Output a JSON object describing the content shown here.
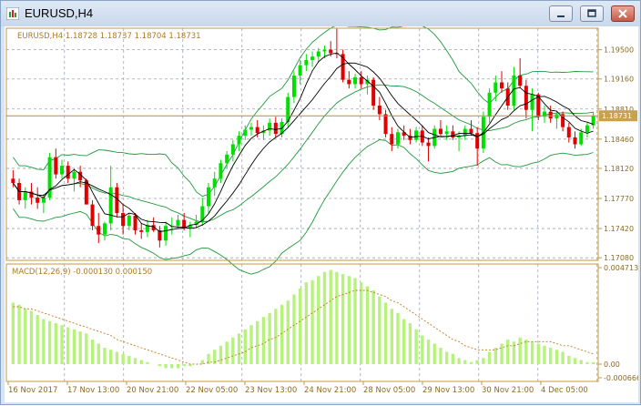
{
  "window": {
    "title": "EURUSD,H4",
    "buttons": [
      "minimize-icon",
      "restore-icon",
      "close-icon"
    ]
  },
  "colors": {
    "grid": "#9aa5b5",
    "axis": "#c89a3c",
    "bull": "#00e000",
    "bear": "#e00000",
    "bands": "#1f9a3a",
    "ma": "#000000",
    "macd_hist": "#b6f27c",
    "macd_signal": "#c8781e",
    "price_line": "#b08d4a"
  },
  "chart_data": {
    "type": "candlestick",
    "symbol_info": "EURUSD,H4  1.18728 1.18737 1.18704 1.18731",
    "current_price_label": "1.18731",
    "current_price": 1.18731,
    "price_axis_ticks": [
      "1.19500",
      "1.19160",
      "1.18810",
      "1.18460",
      "1.18120",
      "1.17770",
      "1.17420",
      "1.17080"
    ],
    "price_axis_values": [
      1.195,
      1.1916,
      1.1881,
      1.1846,
      1.1812,
      1.1777,
      1.1742,
      1.1708
    ],
    "ylim": [
      1.1705,
      1.1975
    ],
    "time_axis_labels": [
      "16 Nov 2017",
      "17 Nov 13:00",
      "20 Nov 21:00",
      "22 Nov 05:00",
      "23 Nov 13:00",
      "24 Nov 21:00",
      "28 Nov 05:00",
      "29 Nov 13:00",
      "30 Nov 21:00",
      "4 Dec 05:00"
    ],
    "candles": [
      [
        1.18,
        1.181,
        1.179,
        1.1795
      ],
      [
        1.1795,
        1.18,
        1.177,
        1.1775
      ],
      [
        1.1775,
        1.179,
        1.1765,
        1.1785
      ],
      [
        1.1785,
        1.1795,
        1.177,
        1.1778
      ],
      [
        1.1778,
        1.179,
        1.1765,
        1.1772
      ],
      [
        1.1772,
        1.1782,
        1.176,
        1.1778
      ],
      [
        1.1778,
        1.183,
        1.1775,
        1.1825
      ],
      [
        1.1825,
        1.1835,
        1.18,
        1.1805
      ],
      [
        1.1805,
        1.1822,
        1.18,
        1.1815
      ],
      [
        1.1815,
        1.182,
        1.1795,
        1.18
      ],
      [
        1.18,
        1.1812,
        1.1785,
        1.1808
      ],
      [
        1.1808,
        1.1815,
        1.179,
        1.1798
      ],
      [
        1.1798,
        1.18,
        1.177,
        1.177
      ],
      [
        1.177,
        1.1775,
        1.174,
        1.1745
      ],
      [
        1.1745,
        1.176,
        1.1725,
        1.1735
      ],
      [
        1.1735,
        1.175,
        1.1728,
        1.1748
      ],
      [
        1.1748,
        1.1815,
        1.174,
        1.179
      ],
      [
        1.179,
        1.1795,
        1.1755,
        1.176
      ],
      [
        1.176,
        1.177,
        1.1735,
        1.1745
      ],
      [
        1.1745,
        1.176,
        1.174,
        1.1757
      ],
      [
        1.1757,
        1.176,
        1.1735,
        1.174
      ],
      [
        1.174,
        1.1748,
        1.173,
        1.1738
      ],
      [
        1.1738,
        1.1752,
        1.1732,
        1.1746
      ],
      [
        1.1746,
        1.1755,
        1.1738,
        1.174
      ],
      [
        1.174,
        1.1745,
        1.172,
        1.1728
      ],
      [
        1.1728,
        1.175,
        1.1722,
        1.1745
      ],
      [
        1.1745,
        1.1755,
        1.1735,
        1.1745
      ],
      [
        1.1745,
        1.1758,
        1.1742,
        1.1752
      ],
      [
        1.1752,
        1.176,
        1.174,
        1.1742
      ],
      [
        1.1742,
        1.175,
        1.1732,
        1.1746
      ],
      [
        1.1746,
        1.1758,
        1.1742,
        1.175
      ],
      [
        1.175,
        1.1778,
        1.1745,
        1.1768
      ],
      [
        1.1768,
        1.1795,
        1.176,
        1.179
      ],
      [
        1.179,
        1.1808,
        1.178,
        1.18
      ],
      [
        1.18,
        1.1822,
        1.1795,
        1.1818
      ],
      [
        1.1818,
        1.1832,
        1.1812,
        1.1828
      ],
      [
        1.1828,
        1.1845,
        1.182,
        1.184
      ],
      [
        1.184,
        1.1855,
        1.1832,
        1.185
      ],
      [
        1.185,
        1.1862,
        1.1845,
        1.1857
      ],
      [
        1.1857,
        1.1865,
        1.185,
        1.186
      ],
      [
        1.186,
        1.1868,
        1.1848,
        1.1853
      ],
      [
        1.1853,
        1.1862,
        1.1845,
        1.1856
      ],
      [
        1.1856,
        1.187,
        1.185,
        1.1865
      ],
      [
        1.1865,
        1.1872,
        1.1848,
        1.1852
      ],
      [
        1.1852,
        1.187,
        1.1848,
        1.1866
      ],
      [
        1.1866,
        1.19,
        1.186,
        1.1895
      ],
      [
        1.1895,
        1.1925,
        1.1888,
        1.192
      ],
      [
        1.192,
        1.1938,
        1.191,
        1.1932
      ],
      [
        1.1932,
        1.1945,
        1.1925,
        1.1938
      ],
      [
        1.1938,
        1.1948,
        1.193,
        1.1942
      ],
      [
        1.1942,
        1.1952,
        1.1935,
        1.1948
      ],
      [
        1.1948,
        1.1955,
        1.194,
        1.195
      ],
      [
        1.195,
        1.196,
        1.1942,
        1.1946
      ],
      [
        1.1946,
        1.1975,
        1.194,
        1.1945
      ],
      [
        1.1945,
        1.195,
        1.1912,
        1.1915
      ],
      [
        1.1915,
        1.1925,
        1.1905,
        1.191
      ],
      [
        1.191,
        1.1922,
        1.1905,
        1.1918
      ],
      [
        1.1918,
        1.1925,
        1.1905,
        1.191
      ],
      [
        1.191,
        1.192,
        1.1898,
        1.1915
      ],
      [
        1.1915,
        1.1918,
        1.188,
        1.1885
      ],
      [
        1.1885,
        1.1895,
        1.1868,
        1.1875
      ],
      [
        1.1875,
        1.188,
        1.1848,
        1.1852
      ],
      [
        1.1852,
        1.186,
        1.1832,
        1.184
      ],
      [
        1.184,
        1.1858,
        1.1835,
        1.1854
      ],
      [
        1.1854,
        1.1862,
        1.1845,
        1.185
      ],
      [
        1.185,
        1.1858,
        1.184,
        1.1845
      ],
      [
        1.1845,
        1.186,
        1.1842,
        1.1856
      ],
      [
        1.1856,
        1.1862,
        1.1838,
        1.1842
      ],
      [
        1.1842,
        1.1848,
        1.182,
        1.1838
      ],
      [
        1.1838,
        1.1862,
        1.1835,
        1.1858
      ],
      [
        1.1858,
        1.1868,
        1.185,
        1.1852
      ],
      [
        1.1852,
        1.1862,
        1.1845,
        1.1855
      ],
      [
        1.1855,
        1.1862,
        1.1845,
        1.1848
      ],
      [
        1.1848,
        1.1855,
        1.1832,
        1.185
      ],
      [
        1.185,
        1.1862,
        1.1845,
        1.1858
      ],
      [
        1.1858,
        1.1868,
        1.185,
        1.1853
      ],
      [
        1.1853,
        1.186,
        1.1815,
        1.1835
      ],
      [
        1.1835,
        1.1878,
        1.183,
        1.1872
      ],
      [
        1.1872,
        1.1905,
        1.1865,
        1.19
      ],
      [
        1.19,
        1.192,
        1.189,
        1.1912
      ],
      [
        1.1912,
        1.1925,
        1.19,
        1.1905
      ],
      [
        1.1905,
        1.1912,
        1.188,
        1.1885
      ],
      [
        1.1885,
        1.193,
        1.188,
        1.192
      ],
      [
        1.192,
        1.194,
        1.1905,
        1.1908
      ],
      [
        1.1908,
        1.1915,
        1.187,
        1.188
      ],
      [
        1.188,
        1.1905,
        1.1855,
        1.1898
      ],
      [
        1.1898,
        1.19,
        1.1868,
        1.1872
      ],
      [
        1.1872,
        1.1885,
        1.1865,
        1.1878
      ],
      [
        1.1878,
        1.1885,
        1.1865,
        1.187
      ],
      [
        1.187,
        1.1878,
        1.1858,
        1.1875
      ],
      [
        1.1875,
        1.1878,
        1.1855,
        1.186
      ],
      [
        1.186,
        1.1865,
        1.1842,
        1.1848
      ],
      [
        1.1848,
        1.1855,
        1.1835,
        1.184
      ],
      [
        1.184,
        1.1858,
        1.1838,
        1.1854
      ],
      [
        1.1854,
        1.1865,
        1.1848,
        1.1862
      ],
      [
        1.1862,
        1.1878,
        1.1858,
        1.1873
      ]
    ],
    "indicators": {
      "moving_averages": true,
      "bollinger_bands": true
    },
    "macd": {
      "label": "MACD(12,26,9) -0.000130 0.000150",
      "axis_ticks": [
        "0.004713",
        "0.00",
        "-0.000666"
      ],
      "axis_values": [
        0.004713,
        0.0,
        -0.000666
      ],
      "ylim": [
        -0.000666,
        0.004713
      ],
      "histogram": [
        0.003,
        0.0029,
        0.0027,
        0.0026,
        0.0024,
        0.0022,
        0.0021,
        0.002,
        0.0019,
        0.0018,
        0.0017,
        0.0016,
        0.0015,
        0.0012,
        0.001,
        0.0008,
        0.0007,
        0.0006,
        0.0005,
        0.0004,
        0.0003,
        0.0002,
        0.0001,
        0.0,
        -0.0001,
        -0.0002,
        -0.0002,
        -0.0002,
        -0.0001,
        -0.0001,
        0.0,
        0.0002,
        0.0005,
        0.0007,
        0.0009,
        0.0011,
        0.0013,
        0.0015,
        0.0017,
        0.0019,
        0.0021,
        0.0023,
        0.0025,
        0.0027,
        0.0029,
        0.0031,
        0.0034,
        0.0037,
        0.004,
        0.0041,
        0.0043,
        0.0045,
        0.0046,
        0.0045,
        0.0044,
        0.0043,
        0.0042,
        0.004,
        0.0038,
        0.0036,
        0.0033,
        0.003,
        0.0027,
        0.0025,
        0.0022,
        0.002,
        0.0017,
        0.0014,
        0.0012,
        0.001,
        0.0008,
        0.0006,
        0.0005,
        0.0003,
        0.0002,
        0.0001,
        0.0002,
        0.0003,
        0.0006,
        0.0008,
        0.001,
        0.0012,
        0.0011,
        0.0013,
        0.0012,
        0.0011,
        0.001,
        0.0009,
        0.0008,
        0.0007,
        0.0006,
        0.0004,
        0.0003,
        0.0002,
        0.0001,
        0.0001
      ],
      "signal": [
        0.0028,
        0.0028,
        0.0027,
        0.0027,
        0.0026,
        0.0025,
        0.0024,
        0.0023,
        0.0022,
        0.0021,
        0.002,
        0.0019,
        0.0018,
        0.0017,
        0.0016,
        0.0015,
        0.0014,
        0.0012,
        0.0011,
        0.001,
        0.0009,
        0.0008,
        0.0007,
        0.0006,
        0.0005,
        0.0004,
        0.0003,
        0.0002,
        0.0001,
        0.0,
        0.0,
        0.0,
        0.0001,
        0.0001,
        0.0002,
        0.0003,
        0.0004,
        0.0005,
        0.0006,
        0.0008,
        0.0009,
        0.001,
        0.0012,
        0.0013,
        0.0015,
        0.0017,
        0.0019,
        0.0021,
        0.0023,
        0.0025,
        0.0027,
        0.0029,
        0.0031,
        0.0033,
        0.0034,
        0.0035,
        0.0036,
        0.0036,
        0.0036,
        0.0035,
        0.0034,
        0.0033,
        0.0031,
        0.003,
        0.0028,
        0.0026,
        0.0024,
        0.0022,
        0.002,
        0.0018,
        0.0016,
        0.0014,
        0.0012,
        0.0011,
        0.0009,
        0.0008,
        0.0007,
        0.0007,
        0.0007,
        0.0007,
        0.0008,
        0.0009,
        0.0009,
        0.001,
        0.0011,
        0.0011,
        0.0011,
        0.0011,
        0.0011,
        0.001,
        0.0009,
        0.0009,
        0.0008,
        0.0007,
        0.0006,
        0.0005
      ]
    }
  }
}
